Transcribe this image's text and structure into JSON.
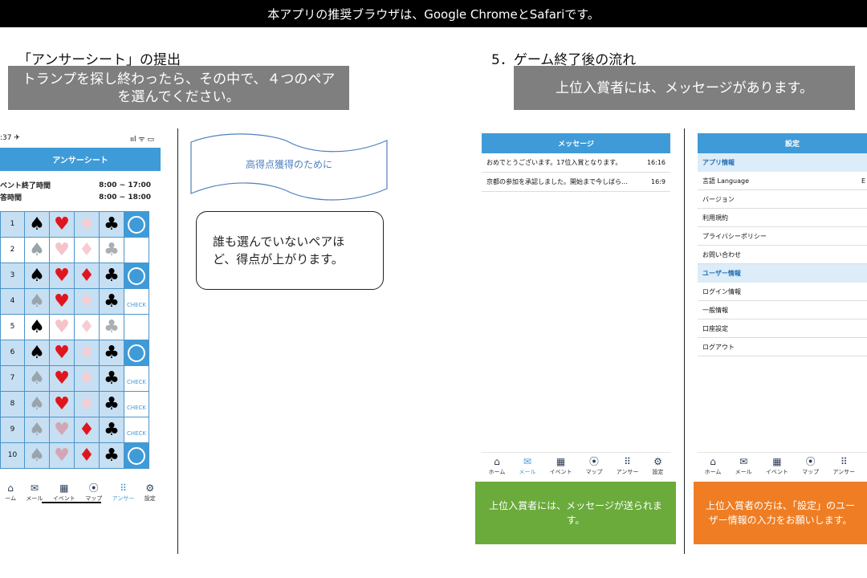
{
  "banner": "本アプリの推奨ブラウザは、Google ChromeとSafariです。",
  "left": {
    "heading": "「アンサーシート」の提出",
    "instruction": "トランプを探し終わったら、その中で、４つのペアを選んでください。",
    "phone": {
      "time": ":37 ✈",
      "status_icons": "ııl ᯤ ▭",
      "title": "アンサーシート",
      "rows": [
        {
          "label": "ベント終了時間",
          "value": "8:00 ~ 17:00"
        },
        {
          "label": "答時間",
          "value": "8:00 ~ 18:00"
        }
      ],
      "check_label": "CHECK",
      "card_rows": [
        {
          "n": "1",
          "s": "b",
          "h": "r",
          "d": "p",
          "c": "b",
          "sel": true,
          "ctl": "circle"
        },
        {
          "n": "2",
          "s": "g",
          "h": "p",
          "d": "p",
          "c": "g",
          "sel": false,
          "ctl": "none"
        },
        {
          "n": "3",
          "s": "b",
          "h": "r",
          "d": "r",
          "c": "b",
          "sel": true,
          "ctl": "circle"
        },
        {
          "n": "4",
          "s": "g",
          "h": "r",
          "d": "p",
          "c": "b",
          "sel": true,
          "ctl": "check"
        },
        {
          "n": "5",
          "s": "b",
          "h": "p",
          "d": "p",
          "c": "g",
          "sel": false,
          "ctl": "none"
        },
        {
          "n": "6",
          "s": "b",
          "h": "r",
          "d": "p",
          "c": "b",
          "sel": true,
          "ctl": "circle"
        },
        {
          "n": "7",
          "s": "g",
          "h": "r",
          "d": "p",
          "c": "b",
          "sel": true,
          "ctl": "check"
        },
        {
          "n": "8",
          "s": "g",
          "h": "r",
          "d": "p",
          "c": "b",
          "sel": true,
          "ctl": "check"
        },
        {
          "n": "9",
          "s": "g",
          "h": "m",
          "d": "r",
          "c": "b",
          "sel": true,
          "ctl": "check"
        },
        {
          "n": "10",
          "s": "g",
          "h": "m",
          "d": "r",
          "c": "b",
          "sel": true,
          "ctl": "circle"
        }
      ],
      "nav": [
        "ーム",
        "メール",
        "イベント",
        "マップ",
        "アンサー",
        "設定"
      ]
    },
    "banner_shape": "高得点獲得のために",
    "callout": "誰も選んでいないペアほど、得点が上がります。"
  },
  "right": {
    "heading": "5．ゲーム終了後の流れ",
    "instruction": "上位入賞者には、メッセージがあります。",
    "message_phone": {
      "title": "メッセージ",
      "messages": [
        {
          "text": "おめでとうございます。17位入賞となります。",
          "time": "16:16"
        },
        {
          "text": "京都の参加を承認しました。開始まで今しばら…",
          "time": "16:9"
        }
      ],
      "nav": [
        "ホーム",
        "メール",
        "イベント",
        "マップ",
        "アンサー",
        "設定"
      ]
    },
    "settings_phone": {
      "title": "設定",
      "section1": "アプリ情報",
      "lang_label": "言語 Language",
      "lang_value": "E",
      "items1": [
        "バージョン",
        "利用規約",
        "プライバシーポリシー",
        "お問い合わせ"
      ],
      "section2": "ユーザー情報",
      "items2": [
        "ログイン情報",
        "一般情報",
        "口座設定",
        "ログアウト"
      ],
      "nav": [
        "ホーム",
        "メール",
        "イベント",
        "マップ",
        "アンサー",
        "設定"
      ]
    },
    "green_note": "上位入賞者には、メッセージが送られます。",
    "orange_note": "上位入賞者の方は、「設定」のユーザー情報の入力をお願いします。"
  },
  "colors": {
    "accent": "#3f9bd8",
    "green": "#6aab3b",
    "orange": "#ef7d24",
    "gray": "#7f7f7f"
  },
  "icons": {
    "nav": [
      "home-icon",
      "mail-icon",
      "calendar-icon",
      "map-pin-icon",
      "grid-icon",
      "gear-icon"
    ]
  }
}
